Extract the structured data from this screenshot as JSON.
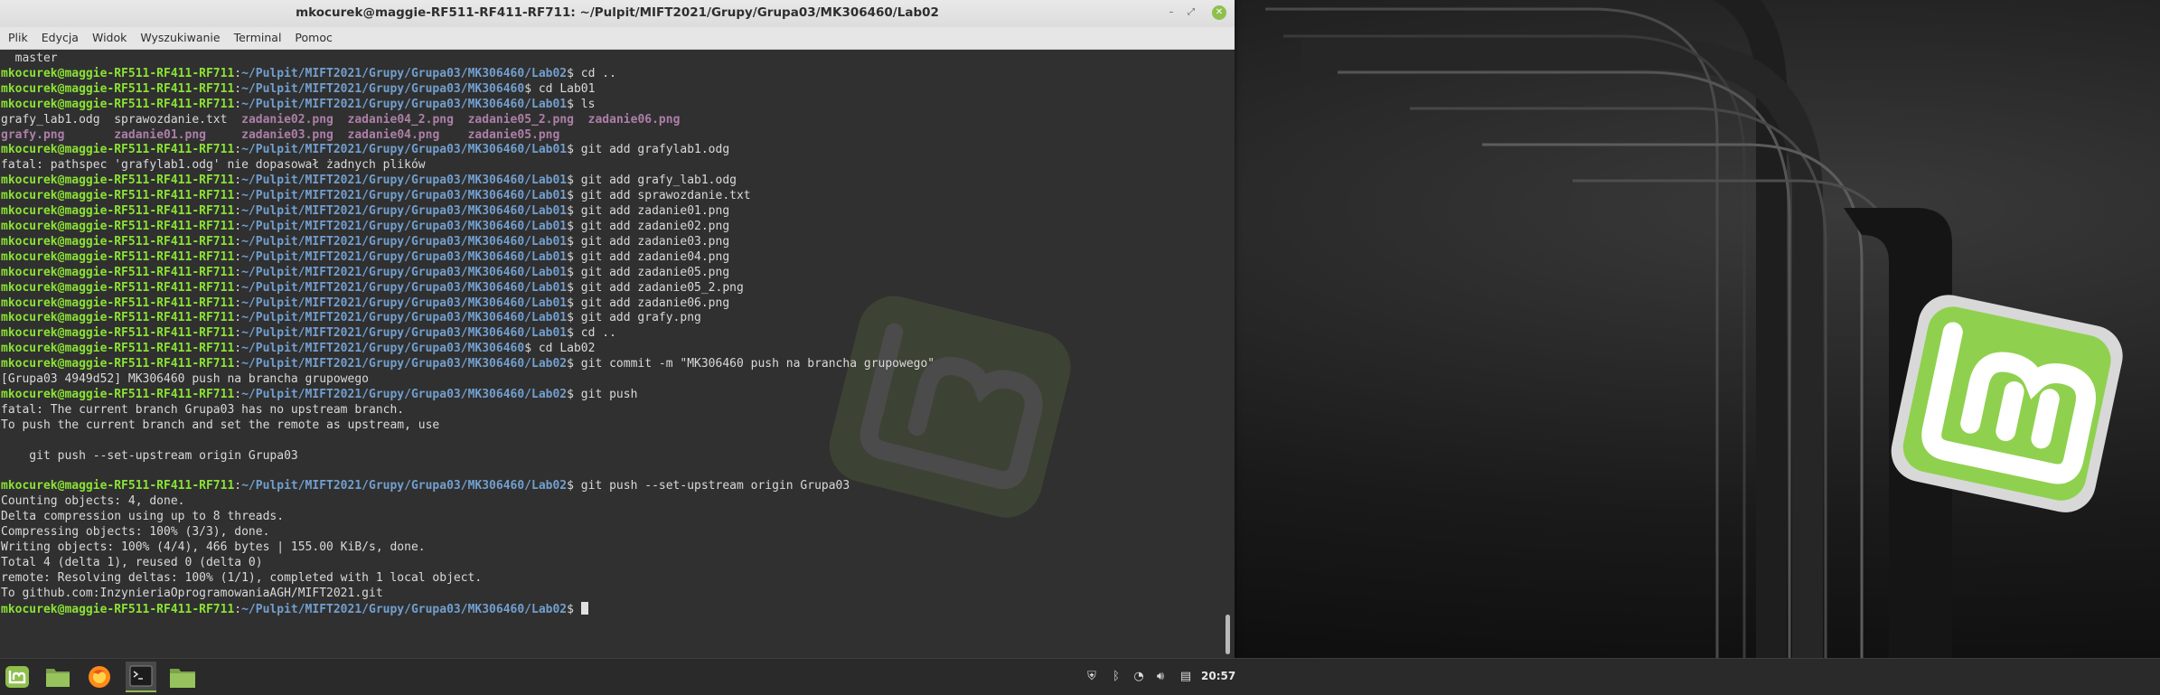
{
  "window": {
    "title": "mkocurek@maggie-RF511-RF411-RF711: ~/Pulpit/MIFT2021/Grupy/Grupa03/MK306460/Lab02"
  },
  "menu": [
    "Plik",
    "Edycja",
    "Widok",
    "Wyszukiwanie",
    "Terminal",
    "Pomoc"
  ],
  "prompt": {
    "user": "mkocurek@maggie-RF511-RF411-RF711",
    "base": "~/Pulpit/MIFT2021/Grupy/Grupa03/MK306460"
  },
  "lines": [
    {
      "t": "out",
      "text": "  master"
    },
    {
      "t": "cmd",
      "dir": "/Lab02",
      "cmd": "cd .."
    },
    {
      "t": "cmd",
      "dir": "",
      "cmd": "cd Lab01"
    },
    {
      "t": "cmd",
      "dir": "/Lab01",
      "cmd": "ls"
    },
    {
      "t": "ls1"
    },
    {
      "t": "ls2"
    },
    {
      "t": "cmd",
      "dir": "/Lab01",
      "cmd": "git add grafylab1.odg"
    },
    {
      "t": "out",
      "text": "fatal: pathspec 'grafylab1.odg' nie dopasował żadnych plików"
    },
    {
      "t": "cmd",
      "dir": "/Lab01",
      "cmd": "git add grafy_lab1.odg"
    },
    {
      "t": "cmd",
      "dir": "/Lab01",
      "cmd": "git add sprawozdanie.txt"
    },
    {
      "t": "cmd",
      "dir": "/Lab01",
      "cmd": "git add zadanie01.png"
    },
    {
      "t": "cmd",
      "dir": "/Lab01",
      "cmd": "git add zadanie02.png"
    },
    {
      "t": "cmd",
      "dir": "/Lab01",
      "cmd": "git add zadanie03.png"
    },
    {
      "t": "cmd",
      "dir": "/Lab01",
      "cmd": "git add zadanie04.png"
    },
    {
      "t": "cmd",
      "dir": "/Lab01",
      "cmd": "git add zadanie05.png"
    },
    {
      "t": "cmd",
      "dir": "/Lab01",
      "cmd": "git add zadanie05_2.png"
    },
    {
      "t": "cmd",
      "dir": "/Lab01",
      "cmd": "git add zadanie06.png"
    },
    {
      "t": "cmd",
      "dir": "/Lab01",
      "cmd": "git add grafy.png"
    },
    {
      "t": "cmd",
      "dir": "/Lab01",
      "cmd": "cd .."
    },
    {
      "t": "cmd",
      "dir": "",
      "cmd": "cd Lab02"
    },
    {
      "t": "cmd",
      "dir": "/Lab02",
      "cmd": "git commit -m \"MK306460 push na brancha grupowego\""
    },
    {
      "t": "out",
      "text": "[Grupa03 4949d52] MK306460 push na brancha grupowego"
    },
    {
      "t": "cmd",
      "dir": "/Lab02",
      "cmd": "git push"
    },
    {
      "t": "out",
      "text": "fatal: The current branch Grupa03 has no upstream branch."
    },
    {
      "t": "out",
      "text": "To push the current branch and set the remote as upstream, use"
    },
    {
      "t": "out",
      "text": ""
    },
    {
      "t": "out",
      "text": "    git push --set-upstream origin Grupa03"
    },
    {
      "t": "out",
      "text": ""
    },
    {
      "t": "cmd",
      "dir": "/Lab02",
      "cmd": "git push --set-upstream origin Grupa03"
    },
    {
      "t": "out",
      "text": "Counting objects: 4, done."
    },
    {
      "t": "out",
      "text": "Delta compression using up to 8 threads."
    },
    {
      "t": "out",
      "text": "Compressing objects: 100% (3/3), done."
    },
    {
      "t": "out",
      "text": "Writing objects: 100% (4/4), 466 bytes | 155.00 KiB/s, done."
    },
    {
      "t": "out",
      "text": "Total 4 (delta 1), reused 0 (delta 0)"
    },
    {
      "t": "out",
      "text": "remote: Resolving deltas: 100% (1/1), completed with 1 local object."
    },
    {
      "t": "out",
      "text": "To github.com:InzynieriaOprogramowaniaAGH/MIFT2021.git"
    },
    {
      "t": "cursor",
      "dir": "/Lab02"
    }
  ],
  "ls": {
    "row1": [
      {
        "name": "grafy_lab1.odg",
        "kind": "file"
      },
      {
        "name": "sprawozdanie.txt",
        "kind": "file"
      },
      {
        "name": "zadanie02.png",
        "kind": "img"
      },
      {
        "name": "zadanie04_2.png",
        "kind": "img"
      },
      {
        "name": "zadanie05_2.png",
        "kind": "img"
      },
      {
        "name": "zadanie06.png",
        "kind": "img"
      }
    ],
    "row2": [
      {
        "name": "grafy.png",
        "kind": "img"
      },
      {
        "name": "zadanie01.png",
        "kind": "img"
      },
      {
        "name": "zadanie03.png",
        "kind": "img"
      },
      {
        "name": "zadanie04.png",
        "kind": "img"
      },
      {
        "name": "zadanie05.png",
        "kind": "img"
      }
    ]
  },
  "taskbar": {
    "apps": [
      {
        "name": "mint-menu",
        "icon": "mint-logo-icon"
      },
      {
        "name": "file-manager",
        "icon": "folder-icon"
      },
      {
        "name": "firefox",
        "icon": "firefox-icon"
      },
      {
        "name": "terminal",
        "icon": "terminal-icon"
      },
      {
        "name": "files-window",
        "icon": "folder-icon"
      }
    ],
    "tray": [
      "shield-icon",
      "bluetooth-icon",
      "wifi-icon",
      "volume-icon",
      "clipboard-icon"
    ],
    "clock": "20:57"
  },
  "colors": {
    "prompt_user": "#8ae234",
    "prompt_path": "#729fcf",
    "image_file": "#ad7fa8",
    "mint_green": "#8fbf4d"
  }
}
